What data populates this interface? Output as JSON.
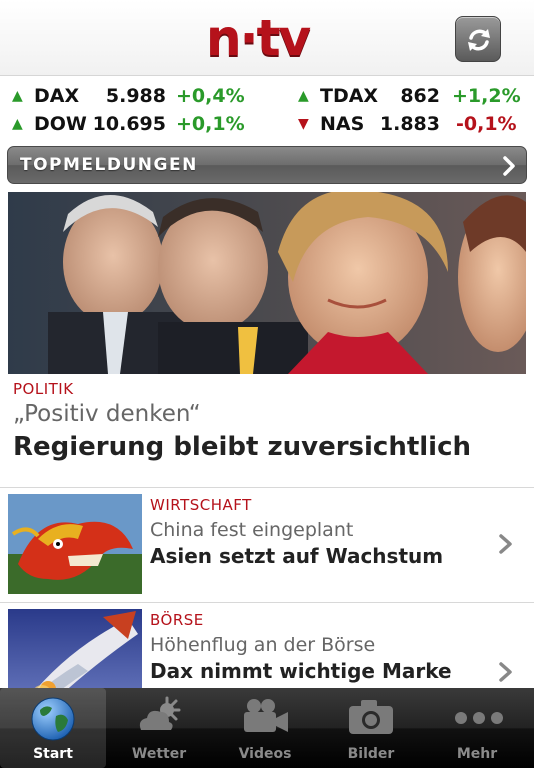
{
  "app": {
    "logo_text": "n·tv"
  },
  "header": {
    "refresh_icon": "refresh-icon"
  },
  "ticker": [
    {
      "name": "DAX",
      "value": "5.988",
      "change": "+0,4%",
      "direction": "up"
    },
    {
      "name": "TDAX",
      "value": "862",
      "change": "+1,2%",
      "direction": "up"
    },
    {
      "name": "DOW",
      "value": "10.695",
      "change": "+0,1%",
      "direction": "up"
    },
    {
      "name": "NAS",
      "value": "1.883",
      "change": "-0,1%",
      "direction": "down"
    }
  ],
  "topbar": {
    "label": "TOPMELDUNGEN"
  },
  "hero": {
    "category": "POLITIK",
    "subtitle": "„Positiv denken“",
    "title": "Regierung bleibt zuversichtlich"
  },
  "articles": [
    {
      "category": "WIRTSCHAFT",
      "subtitle": "China fest eingeplant",
      "title": "Asien setzt auf Wachstum"
    },
    {
      "category": "BÖRSE",
      "subtitle": "Höhenflug an der Börse",
      "title": "Dax nimmt wichtige Marke"
    }
  ],
  "tabs": [
    {
      "label": "Start",
      "icon": "globe-icon",
      "active": true
    },
    {
      "label": "Wetter",
      "icon": "weather-icon",
      "active": false
    },
    {
      "label": "Videos",
      "icon": "video-camera-icon",
      "active": false
    },
    {
      "label": "Bilder",
      "icon": "photo-camera-icon",
      "active": false
    },
    {
      "label": "Mehr",
      "icon": "more-dots-icon",
      "active": false
    }
  ],
  "colors": {
    "brand_red": "#b5121b",
    "up_green": "#2a9a2a"
  }
}
